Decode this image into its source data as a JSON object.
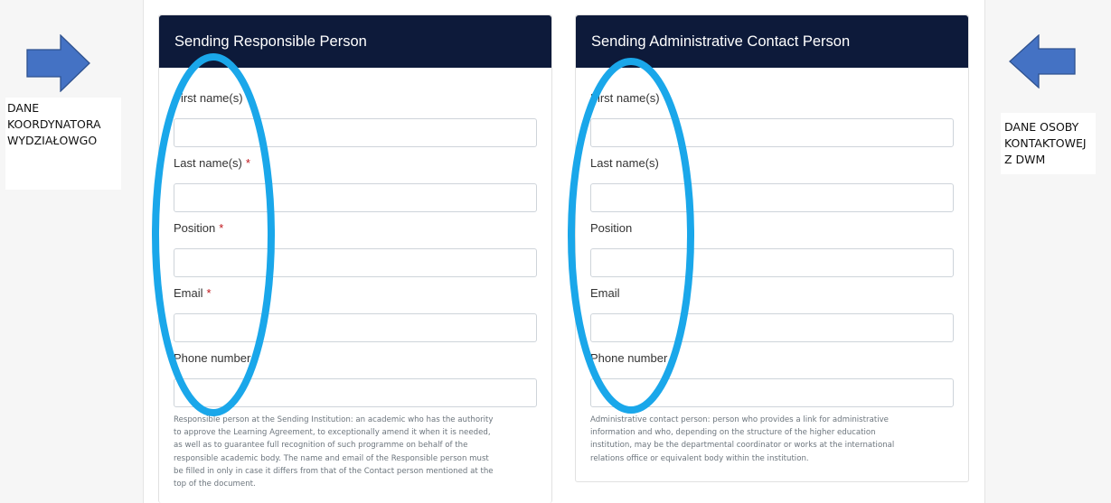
{
  "notes": {
    "left": [
      "DANE",
      "KOORDYNATORA",
      "WYDZIAŁOWGO"
    ],
    "right": [
      "DANE OSOBY",
      "KONTAKTOWEJ",
      "Z DWM"
    ]
  },
  "colors": {
    "header_bg": "#0d1a3a",
    "arrow_fill": "#4472c4",
    "oval_stroke": "#1aa7ea",
    "required_mark": "#c0171d"
  },
  "responsible": {
    "title": "Sending Responsible Person",
    "required_mark": "*",
    "fields": [
      {
        "label": "First name(s)",
        "required": true,
        "value": ""
      },
      {
        "label": "Last name(s)",
        "required": true,
        "value": ""
      },
      {
        "label": "Position",
        "required": true,
        "value": ""
      },
      {
        "label": "Email",
        "required": true,
        "value": ""
      },
      {
        "label": "Phone number",
        "required": false,
        "value": ""
      }
    ],
    "help_lines": [
      "Responsible person at the Sending Institution: an academic who has the authority",
      "to approve the Learning Agreement, to exceptionally amend it when it is needed,",
      "as well as to guarantee full recognition of such programme on behalf of the",
      "responsible academic body. The name and email of the Responsible person must",
      "be filled in only in case it differs from that of the Contact person mentioned at the",
      "top of the document."
    ]
  },
  "administrative": {
    "title": "Sending Administrative Contact Person",
    "fields": [
      {
        "label": "First name(s)",
        "required": false,
        "value": ""
      },
      {
        "label": "Last name(s)",
        "required": false,
        "value": ""
      },
      {
        "label": "Position",
        "required": false,
        "value": ""
      },
      {
        "label": "Email",
        "required": false,
        "value": ""
      },
      {
        "label": "Phone number",
        "required": false,
        "value": ""
      }
    ],
    "help_lines": [
      "Administrative contact person: person who provides a link for administrative",
      "information and who, depending on the structure of the higher education",
      "institution, may be the departmental coordinator or works at the international",
      "relations office or equivalent body within the institution."
    ]
  }
}
